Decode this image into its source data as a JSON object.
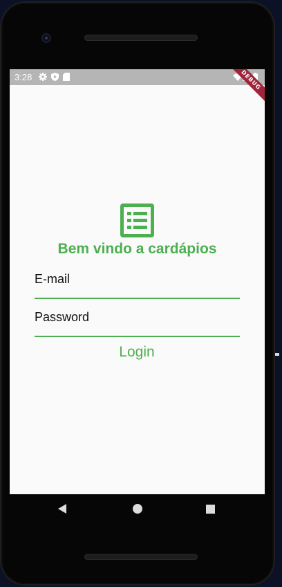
{
  "status_bar": {
    "time": "3:28",
    "icons": [
      "gear-icon",
      "shield-icon",
      "sd-card-icon",
      "wifi-icon",
      "signal-icon",
      "battery-icon"
    ]
  },
  "debug_banner": "DEBUG",
  "app": {
    "logo_icon": "list-alt-icon",
    "welcome": "Bem vindo a cardápios",
    "email_placeholder": "E-mail",
    "password_placeholder": "Password",
    "login_label": "Login"
  },
  "navigation": {
    "back_icon": "back-icon",
    "home_icon": "home-icon",
    "recent_icon": "recent-apps-icon"
  },
  "colors": {
    "accent": "#4caf50",
    "status_bar": "#b5b5b5",
    "screen_background": "#fafafa",
    "debug_banner": "#a0253c"
  }
}
